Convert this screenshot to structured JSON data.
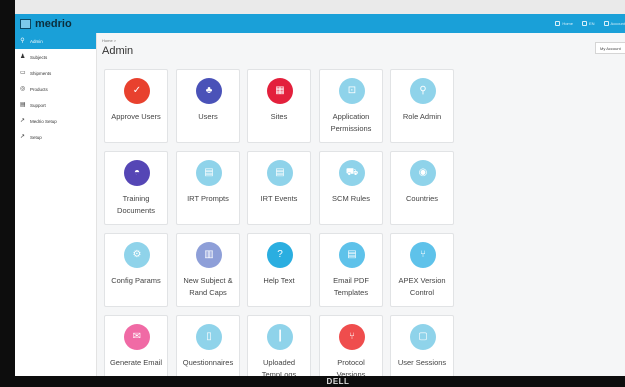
{
  "app": {
    "name": "medrio"
  },
  "topnav": [
    {
      "label": "Home",
      "icon": "home-icon"
    },
    {
      "label": "EN",
      "icon": "globe-icon"
    },
    {
      "label": "Account",
      "icon": "user-icon"
    }
  ],
  "sidebar": {
    "items": [
      {
        "label": "Admin",
        "icon": "wrench-icon",
        "glyph": "⚲",
        "active": true
      },
      {
        "label": "Subjects",
        "icon": "users-icon",
        "glyph": "♟"
      },
      {
        "label": "Shipments",
        "icon": "box-icon",
        "glyph": "▭"
      },
      {
        "label": "Products",
        "icon": "circle-icon",
        "glyph": "◎"
      },
      {
        "label": "Support",
        "icon": "card-icon",
        "glyph": "▤"
      },
      {
        "label": "Medrio Setup",
        "icon": "wrench-icon",
        "glyph": "↗"
      },
      {
        "label": "Setup",
        "icon": "wrench-icon",
        "glyph": "↗"
      }
    ]
  },
  "header": {
    "breadcrumb": "Home >",
    "title": "Admin",
    "account_button": "My Account"
  },
  "tiles": [
    {
      "label": "Approve Users",
      "color": "#e8412e",
      "icon": "thumbs-up-icon",
      "glyph": "✓"
    },
    {
      "label": "Users",
      "color": "#4a52b8",
      "icon": "users-icon",
      "glyph": "♣"
    },
    {
      "label": "Sites",
      "color": "#e3203c",
      "icon": "building-icon",
      "glyph": "▦"
    },
    {
      "label": "Application Permissions",
      "color": "#8fd3ea",
      "icon": "lock-icon",
      "glyph": "⊡"
    },
    {
      "label": "Role Admin",
      "color": "#8fd3ea",
      "icon": "search-icon",
      "glyph": "⚲"
    },
    {
      "label": "Training Documents",
      "color": "#5546b5",
      "icon": "graduation-cap-icon",
      "glyph": "◓"
    },
    {
      "label": "IRT Prompts",
      "color": "#8fd3ea",
      "icon": "document-icon",
      "glyph": "▤"
    },
    {
      "label": "IRT Events",
      "color": "#8fd3ea",
      "icon": "calendar-icon",
      "glyph": "▤"
    },
    {
      "label": "SCM Rules",
      "color": "#8fd3ea",
      "icon": "truck-icon",
      "glyph": "⛟"
    },
    {
      "label": "Countries",
      "color": "#8fd3ea",
      "icon": "globe-icon",
      "glyph": "◉"
    },
    {
      "label": "Config Params",
      "color": "#8fd3ea",
      "icon": "gear-icon",
      "glyph": "⚙"
    },
    {
      "label": "New Subject & Rand Caps",
      "color": "#8e9fd8",
      "icon": "list-icon",
      "glyph": "▥"
    },
    {
      "label": "Help Text",
      "color": "#2aaee0",
      "icon": "help-icon",
      "glyph": "?"
    },
    {
      "label": "Email PDF Templates",
      "color": "#5ec2ea",
      "icon": "pdf-icon",
      "glyph": "▤"
    },
    {
      "label": "APEX Version Control",
      "color": "#5ec2ea",
      "icon": "version-icon",
      "glyph": "⑂"
    },
    {
      "label": "Generate Email",
      "color": "#f06aa5",
      "icon": "envelope-icon",
      "glyph": "✉"
    },
    {
      "label": "Questionnaires",
      "color": "#8fd3ea",
      "icon": "clipboard-icon",
      "glyph": "▯"
    },
    {
      "label": "Uploaded TempLogs",
      "color": "#8fd3ea",
      "icon": "thermometer-icon",
      "glyph": "┃"
    },
    {
      "label": "Protocol Versions",
      "color": "#ef4d4d",
      "icon": "branch-icon",
      "glyph": "⑂"
    },
    {
      "label": "User Sessions",
      "color": "#8fd3ea",
      "icon": "session-icon",
      "glyph": "▢"
    }
  ],
  "brand": {
    "monitor_logo": "DELL"
  },
  "colors": {
    "accent": "#1aa0d8"
  }
}
